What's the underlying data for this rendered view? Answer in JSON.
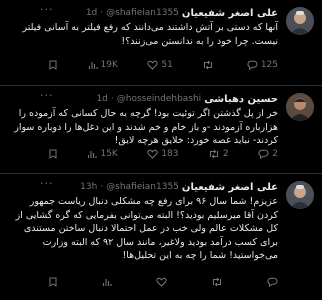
{
  "tweets": [
    {
      "name": "علی اصغر شفیعیان",
      "handle": "@shafieian1355",
      "time": "1d",
      "text": "آنها که دستی بر آتش داشتند می‌دانند که رفع فیلتر به آسانی فیلتر نیست. چرا خود را به ندانستن می‌زنند؟!",
      "actions": {
        "bookmark": "",
        "views": "19K",
        "likes": "51",
        "retweets": "",
        "replies": "125"
      }
    },
    {
      "name": "حسین دهباشی",
      "handle": "@hosseindehbashi",
      "time": "1d",
      "text": "خر از پل گذشتن اگر توئیت بود! گرچه به حال کسانی که آزموده را هزارباره آزمودند -و باز خام و خم شدند و این دغل‌ها را دوباره سوار کردند- نباید غصه خورد: خلایق هرچه لایق!",
      "actions": {
        "bookmark": "",
        "views": "15K",
        "likes": "183",
        "retweets": "2",
        "replies": "2"
      }
    },
    {
      "name": "علی اصغر شفیعیان",
      "handle": "@shafieian1355",
      "time": "13h",
      "text": "عزیزم! شما سال ۹۶ برای رفع چه مشکلی دنبال ریاست جمهور کردن آقا میرسلیم بودید؟! البته می‌توانی بفرمایی که گره گشایی از کل مشکلات عالم ولی خب در عمل احتمالا دنبال ساختن مستندی برای کسب درآمد بودید ولاغیر، مانند سال ۹۲ که البته وزارت می‌خواستید! شما را چه به این تحلیل‌ها!",
      "actions": {
        "bookmark": "",
        "views": "",
        "likes": "",
        "retweets": "",
        "replies": ""
      }
    }
  ],
  "icons": {
    "reply": "reply-icon",
    "retweet": "retweet-icon",
    "like": "heart-icon",
    "views": "views-icon",
    "bookmark": "bookmark-icon",
    "more": "more-icon"
  },
  "colors": {
    "background": "#000000",
    "text": "#e7e9ea",
    "muted": "#71767b",
    "divider": "#2f3336"
  }
}
